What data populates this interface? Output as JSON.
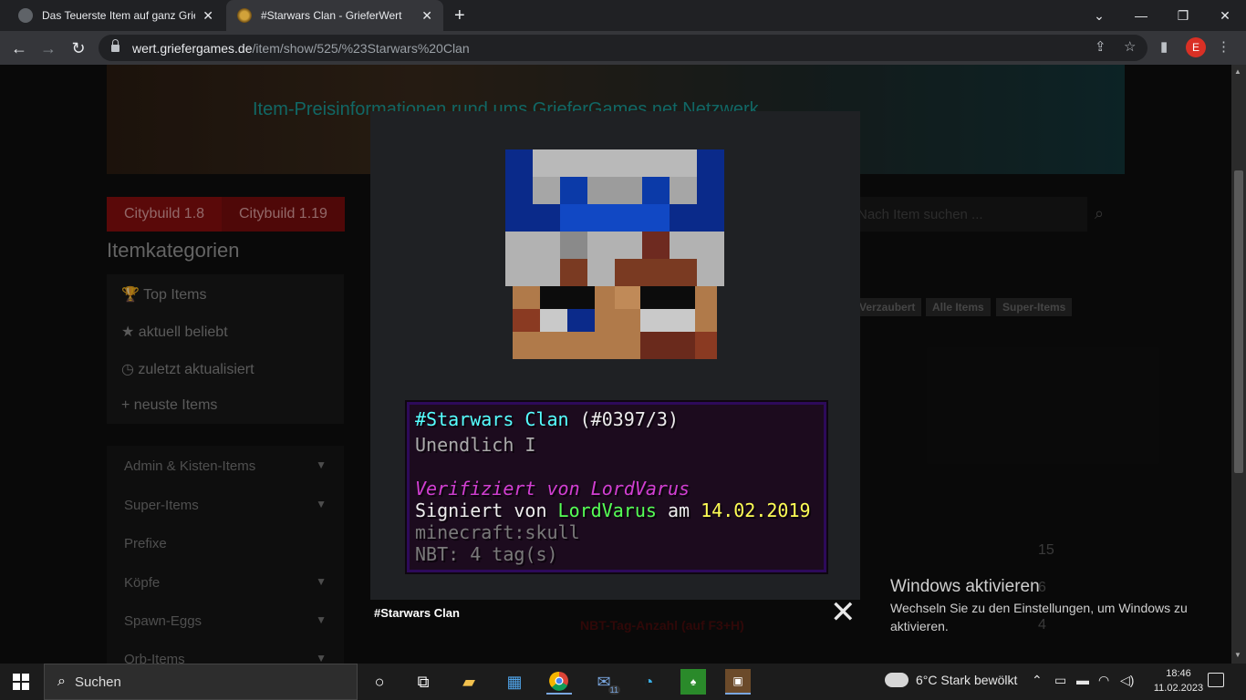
{
  "browser": {
    "tabs": [
      {
        "title": "Das Teuerste Item auf ganz Griefe",
        "active": false
      },
      {
        "title": "#Starwars Clan - GrieferWert",
        "active": true
      }
    ],
    "url_host": "wert.griefergames.de",
    "url_path": "/item/show/525/%23Starwars%20Clan",
    "profile_initial": "E"
  },
  "page": {
    "banner_subtitle": "Item-Preisinformationen rund ums GrieferGames.net Netzwerk",
    "tabs": [
      "Citybuild 1.8",
      "Citybuild 1.19"
    ],
    "search_placeholder": "Nach Item suchen ...",
    "categories_title": "Itemkategorien",
    "quick_links": [
      "Top Items",
      "aktuell beliebt",
      "zuletzt aktualisiert",
      "neuste Items"
    ],
    "categories": [
      {
        "label": "Admin & Kisten-Items",
        "expandable": true
      },
      {
        "label": "Super-Items",
        "expandable": true
      },
      {
        "label": "Prefixe",
        "expandable": false
      },
      {
        "label": "Köpfe",
        "expandable": true
      },
      {
        "label": "Spawn-Eggs",
        "expandable": true
      },
      {
        "label": "Orb-Items",
        "expandable": true
      }
    ],
    "tags": [
      "Verzaubert",
      "Alle Items",
      "Super-Items"
    ],
    "numbers": [
      "15",
      "6",
      "4"
    ],
    "nbt_label": "NBT-Tag-Anzahl (auf F3+H)"
  },
  "lightbox": {
    "caption": "#Starwars Clan",
    "close_label": "✕",
    "tooltip": {
      "name": "#Starwars Clan",
      "id": "(#0397/3)",
      "enchant": "Unendlich I",
      "verified": "Verifiziert von LordVarus",
      "signed_prefix": "Signiert von",
      "signed_by": "LordVarus",
      "signed_mid": "am",
      "signed_date": "14.02.2019",
      "item_id": "minecraft:skull",
      "nbt": "NBT: 4 tag(s)"
    }
  },
  "watermark": {
    "title": "Windows aktivieren",
    "text": "Wechseln Sie zu den Einstellungen, um Windows zu aktivieren."
  },
  "taskbar": {
    "search_label": "Suchen",
    "mail_badge": "11",
    "weather": "6°C  Stark bewölkt",
    "time": "18:46",
    "date": "11.02.2023"
  },
  "colors": {
    "accent_red": "#8b0f0f",
    "mc_aqua": "#55ffff",
    "mc_green": "#55ff55",
    "mc_yellow": "#ffff55",
    "mc_pink": "#d23fd2"
  }
}
